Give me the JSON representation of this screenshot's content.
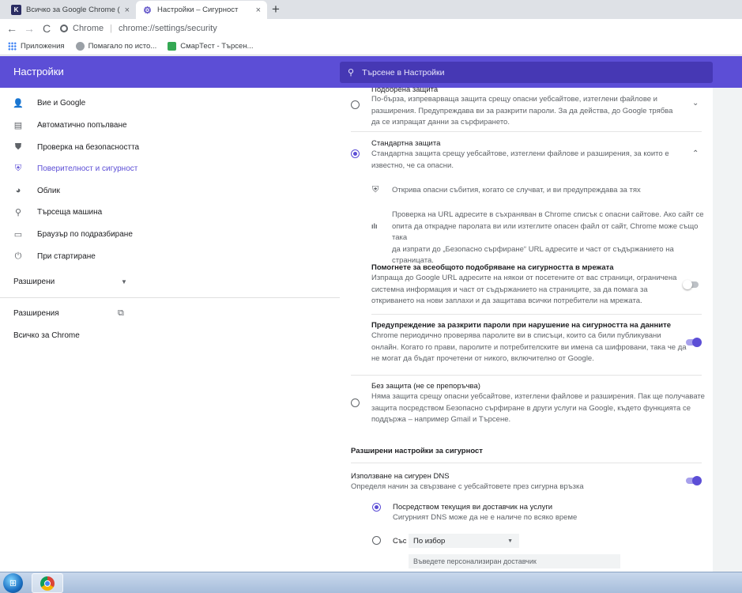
{
  "tabs": [
    {
      "title": "Всичко за Google Chrome (обед",
      "favicon": "K",
      "close": "×"
    },
    {
      "title": "Настройки – Сигурност",
      "favicon": "⚙",
      "close": "×"
    }
  ],
  "new_tab": "+",
  "toolbar": {
    "back": "←",
    "forward": "→",
    "reload": "C",
    "site_label": "Chrome",
    "separator": "|",
    "url": "chrome://settings/security"
  },
  "bookmarks": [
    {
      "label": "Приложения",
      "icon": "apps-icon"
    },
    {
      "label": "Помагало по исто...",
      "icon": "help-icon"
    },
    {
      "label": "СмарТест - Търсен...",
      "icon": "smart-icon"
    }
  ],
  "header": {
    "title": "Настройки",
    "search_placeholder": "Търсене в Настройки",
    "search_icon": "⚲"
  },
  "sidebar": {
    "items": [
      {
        "label": "Вие и Google",
        "icon": "person-icon",
        "glyph": "👤"
      },
      {
        "label": "Автоматично попълване",
        "icon": "clipboard-icon",
        "glyph": "▤"
      },
      {
        "label": "Проверка на безопасността",
        "icon": "shield-check-icon",
        "glyph": "⛊"
      },
      {
        "label": "Поверителност и сигурност",
        "icon": "shield-privacy-icon",
        "glyph": "⛨"
      },
      {
        "label": "Облик",
        "icon": "palette-icon",
        "glyph": "◕"
      },
      {
        "label": "Търсеща машина",
        "icon": "search-icon",
        "glyph": "⚲"
      },
      {
        "label": "Браузър по подразбиране",
        "icon": "browser-icon",
        "glyph": "▭"
      },
      {
        "label": "При стартиране",
        "icon": "power-icon",
        "glyph": "⏻"
      }
    ],
    "advanced": {
      "label": "Разширени",
      "caret": "▼"
    },
    "extensions": {
      "label": "Разширения",
      "glyph": "⧉"
    },
    "about": {
      "label": "Всичко за Chrome"
    }
  },
  "main": {
    "enhanced": {
      "title": "Подобрена защита",
      "desc": [
        "По-бърза, изпреварваща защита срещу опасни уебсайтове, изтеглени файлове и",
        "разширения. Предупреждава ви за разкрити пароли. За да действа, до Google трябва",
        "да се изпращат данни за сърфирането."
      ],
      "chevron": "⌄"
    },
    "standard": {
      "title": "Стандартна защита",
      "desc": [
        "Стандартна защита срещу уебсайтове, изтеглени файлове и разширения, за които е",
        "известно, че са опасни."
      ],
      "chevron": "⌃"
    },
    "detail1": {
      "text": "Открива опасни събития, когато се случват, и ви предупреждава за тях",
      "glyph": "⛨"
    },
    "detail2": {
      "lines": [
        "Проверка на URL адресите в съхраняван в Chrome списък с опасни сайтове. Ако сайт се",
        "опита да открадне паролата ви или изтеглите опасен файл от сайт, Chrome може също така",
        "да изпрати до „Безопасно сърфиране“ URL адресите и част от съдържанието на страницата."
      ],
      "glyph": "ılı"
    },
    "help_improve": {
      "title": "Помогнете за всеобщото подобряване на сигурността в мрежата",
      "desc": [
        "Изпраща до Google URL адресите на някои от посетените от вас страници, ограничена",
        "системна информация и част от съдържанието на страниците, за да помага за",
        "откриването на нови заплахи и да защитава всички потребители на мрежата."
      ],
      "toggle": false
    },
    "password_warn": {
      "title": "Предупреждение за разкрити пароли при нарушение на сигурността на данните",
      "desc": [
        "Chrome периодично проверява паролите ви в списъци, които са били публикувани",
        "онлайн. Когато го прави, паролите и потребителските ви имена са шифровани, така че да",
        "не могат да бъдат прочетени от никого, включително от Google."
      ],
      "toggle": true
    },
    "no_protection": {
      "title": "Без защита (не се препоръчва)",
      "desc": [
        "Няма защита срещу опасни уебсайтове, изтеглени файлове и разширения. Пак ще получавате",
        "защита посредством Безопасно сърфиране в други услуги на Google, където функцията се",
        "поддържа – например Gmail и Търсене."
      ]
    },
    "advanced_head": "Разширени настройки за сигурност",
    "secure_dns": {
      "title": "Използване на сигурен DNS",
      "desc": "Определя начин за свързване с уебсайтовете през сигурна връзка",
      "toggle": true
    },
    "dns_current": {
      "title": "Посредством текущия ви доставчик на услуги",
      "desc": "Сигурният DNS може да не е наличе по всяко време"
    },
    "dns_custom": {
      "label": "Със",
      "select_value": "По избор",
      "select_caret": "▼",
      "input_placeholder": "Въведете персонализиран доставчик"
    }
  },
  "taskbar": {
    "start_glyph": "⊞"
  }
}
